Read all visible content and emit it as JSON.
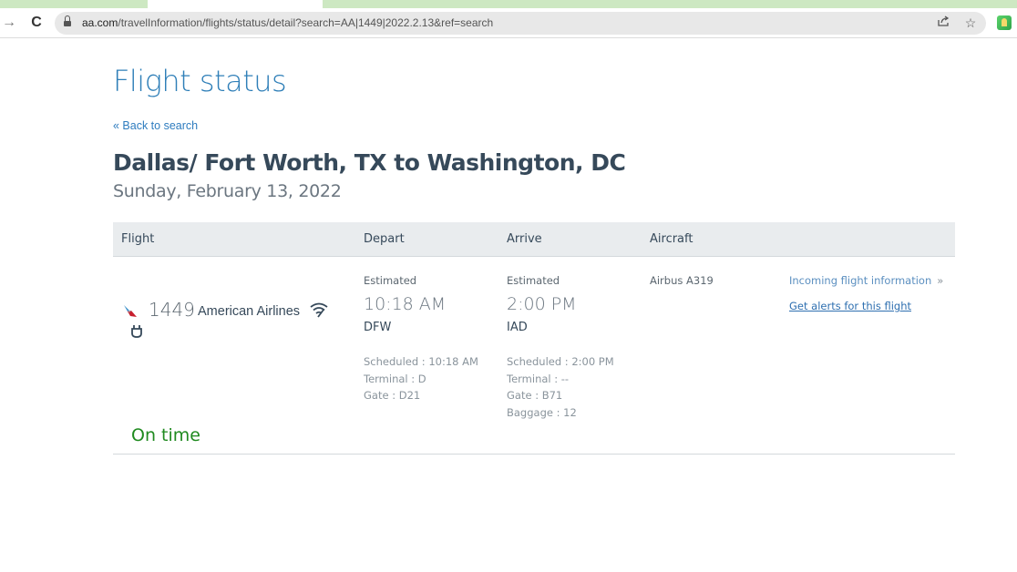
{
  "browser": {
    "url_host": "aa.com",
    "url_path": "/travelInformation/flights/status/detail?search=AA|1449|2022.2.13&ref=search",
    "icons": {
      "forward": "forward-arrow-icon",
      "reload": "reload-icon",
      "lock": "lock-icon",
      "share": "share-icon",
      "bookmark": "star-icon",
      "profile": "profile-icon"
    }
  },
  "page": {
    "title": "Flight status",
    "back_link": "« Back to search",
    "route": "Dallas/ Fort Worth, TX to Washington, DC",
    "date": "Sunday, February 13, 2022"
  },
  "table": {
    "headers": {
      "flight": "Flight",
      "depart": "Depart",
      "arrive": "Arrive",
      "aircraft": "Aircraft"
    },
    "row": {
      "flight_number": "1449",
      "airline": "American Airlines",
      "amenities": [
        "wifi-icon",
        "power-outlet-icon"
      ],
      "status": "On time",
      "status_color": "#1f8a1f",
      "depart": {
        "label": "Estimated",
        "time": "10:18 AM",
        "airport": "DFW",
        "scheduled": "Scheduled : 10:18 AM",
        "terminal": "Terminal : D",
        "gate": "Gate : D21"
      },
      "arrive": {
        "label": "Estimated",
        "time": "2:00 PM",
        "airport": "IAD",
        "scheduled": "Scheduled : 2:00 PM",
        "terminal": "Terminal : --",
        "gate": "Gate : B71",
        "baggage": "Baggage : 12"
      },
      "aircraft": "Airbus A319",
      "incoming_link": "Incoming flight information",
      "incoming_arrow": "»",
      "alerts_link": "Get alerts for this flight"
    }
  },
  "colors": {
    "brand_blue": "#2f7fb8",
    "link_blue": "#2e7cbf",
    "header_bg": "#e9ecee"
  }
}
